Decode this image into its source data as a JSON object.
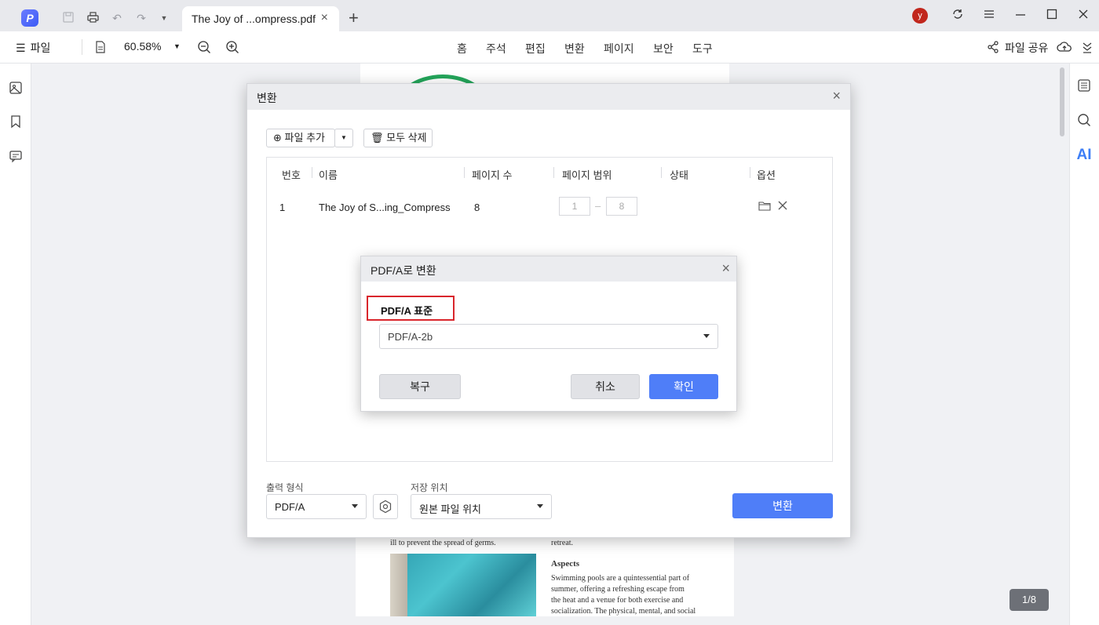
{
  "titlebar": {
    "tab_title": "The Joy of ...ompress.pdf",
    "avatar_initial": "y"
  },
  "toolbar": {
    "file_menu": "파일",
    "zoom": "60.58%",
    "menus": [
      "홈",
      "주석",
      "편집",
      "변환",
      "페이지",
      "보안",
      "도구"
    ],
    "share_label": "파일 공유"
  },
  "right_sidebar": {
    "ai_label": "AI"
  },
  "document": {
    "text_left": "ill to prevent the spread of germs.",
    "text_right_top": "retreat.",
    "heading": "Aspects",
    "paragraph_lines": [
      "Swimming pools are a quintessential part of",
      "summer, offering a refreshing escape from",
      "the heat and a venue for both exercise and",
      "socialization. The physical, mental, and social"
    ],
    "page_counter": "1/8"
  },
  "convert_dialog": {
    "title": "변환",
    "add_file_label": "파일 추가",
    "delete_all_label": "모두 삭제",
    "columns": [
      "번호",
      "이름",
      "페이지 수",
      "페이지 범위",
      "상태",
      "옵션"
    ],
    "rows": [
      {
        "number": "1",
        "name": "The Joy of S...ing_Compress",
        "pages": "8",
        "range_from": "1",
        "range_to": "8",
        "status": ""
      }
    ],
    "output_format_label": "출력 형식",
    "output_format_value": "PDF/A",
    "save_location_label": "저장 위치",
    "save_location_value": "원본 파일 위치",
    "convert_button": "변환"
  },
  "pdfa_dialog": {
    "title": "PDF/A로 변환",
    "standard_label": "PDF/A 표준",
    "standard_value": "PDF/A-2b",
    "reset_button": "복구",
    "cancel_button": "취소",
    "ok_button": "확인"
  },
  "colors": {
    "accent": "#4f7ef8",
    "highlight_border": "#d9262c",
    "avatar": "#c1271d"
  }
}
